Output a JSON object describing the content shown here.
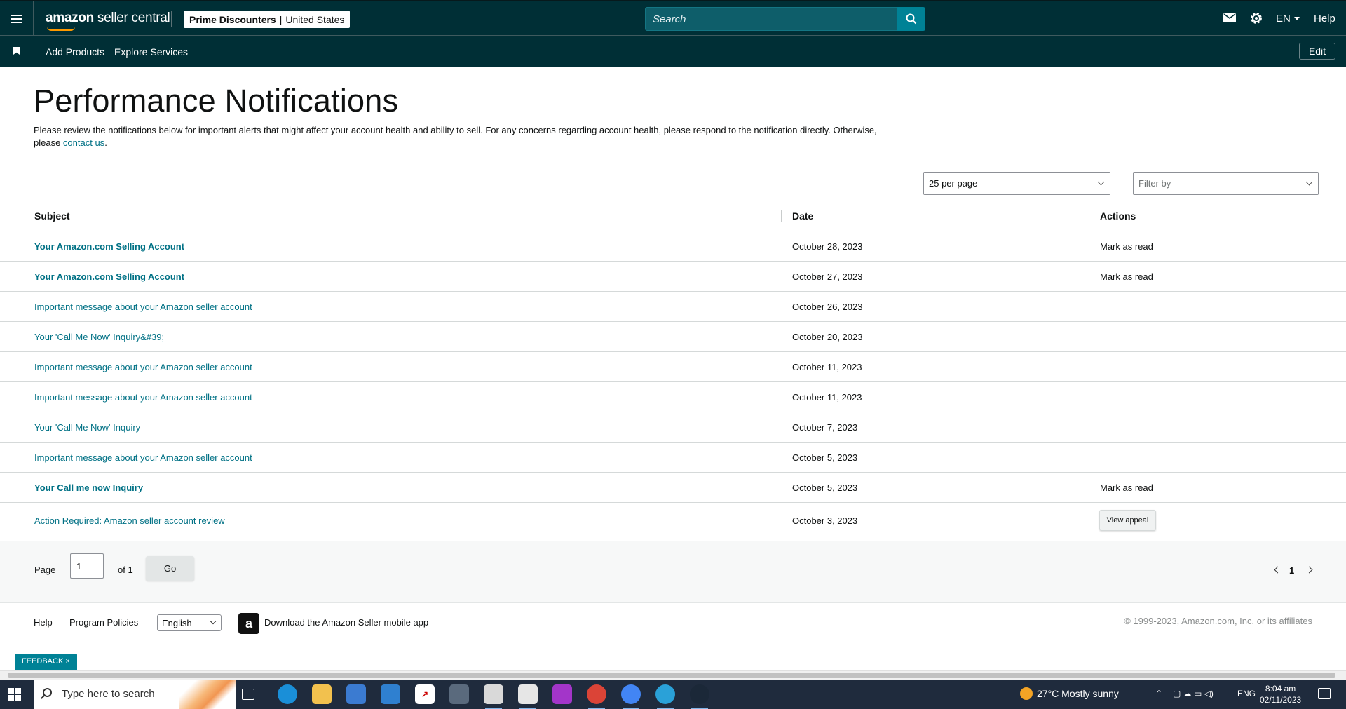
{
  "header": {
    "logo_bold": "amazon",
    "logo_rest": " seller central",
    "store_name": "Prime Discounters",
    "store_region": "United States",
    "search_placeholder": "Search",
    "language": "EN",
    "help": "Help"
  },
  "bookmarks": {
    "items": [
      "Add Products",
      "Explore Services"
    ],
    "edit_label": "Edit"
  },
  "page": {
    "title": "Performance Notifications",
    "description": "Please review the notifications below for important alerts that might affect your account health and ability to sell. For any concerns regarding account health, please respond to the notification directly. Otherwise, please ",
    "contact_link": "contact us",
    "contact_suffix": "."
  },
  "controls": {
    "per_page": "25 per page",
    "filter_placeholder": "Filter by"
  },
  "table": {
    "columns": [
      "Subject",
      "Date",
      "Actions"
    ],
    "rows": [
      {
        "subject": "Your Amazon.com Selling Account",
        "date": "October 28, 2023",
        "action": "Mark as read",
        "unread": true
      },
      {
        "subject": "Your Amazon.com Selling Account",
        "date": "October 27, 2023",
        "action": "Mark as read",
        "unread": true
      },
      {
        "subject": "Important message about your Amazon seller account",
        "date": "October 26, 2023",
        "action": "",
        "unread": false
      },
      {
        "subject": "Your 'Call Me Now' Inquiry&#39;",
        "date": "October 20, 2023",
        "action": "",
        "unread": false
      },
      {
        "subject": "Important message about your Amazon seller account",
        "date": "October 11, 2023",
        "action": "",
        "unread": false
      },
      {
        "subject": "Important message about your Amazon seller account",
        "date": "October 11, 2023",
        "action": "",
        "unread": false
      },
      {
        "subject": "Your 'Call Me Now' Inquiry",
        "date": "October 7, 2023",
        "action": "",
        "unread": false
      },
      {
        "subject": "Important message about your Amazon seller account",
        "date": "October 5, 2023",
        "action": "",
        "unread": false
      },
      {
        "subject": "Your Call me now Inquiry",
        "date": "October 5, 2023",
        "action": "Mark as read",
        "unread": true
      },
      {
        "subject": "Action Required: Amazon seller account review",
        "date": "October 3, 2023",
        "action": "View appeal",
        "unread": false
      }
    ]
  },
  "pagination": {
    "page_label": "Page",
    "current_page": "1",
    "of_label": "of 1",
    "go_label": "Go",
    "page_number": "1"
  },
  "footer": {
    "help": "Help",
    "program_policies": "Program Policies",
    "language": "English",
    "app_promo": "Download the Amazon Seller mobile app",
    "copyright": "© 1999-2023, Amazon.com, Inc. or its affiliates",
    "feedback": "FEEDBACK ×"
  },
  "taskbar": {
    "search_placeholder": "Type here to search",
    "weather": "27°C  Mostly sunny",
    "lang": "ENG",
    "time": "8:04 am",
    "date": "02/11/2023"
  },
  "colors": {
    "nav_bg": "#002f36",
    "link": "#007185",
    "accent": "#008296"
  }
}
